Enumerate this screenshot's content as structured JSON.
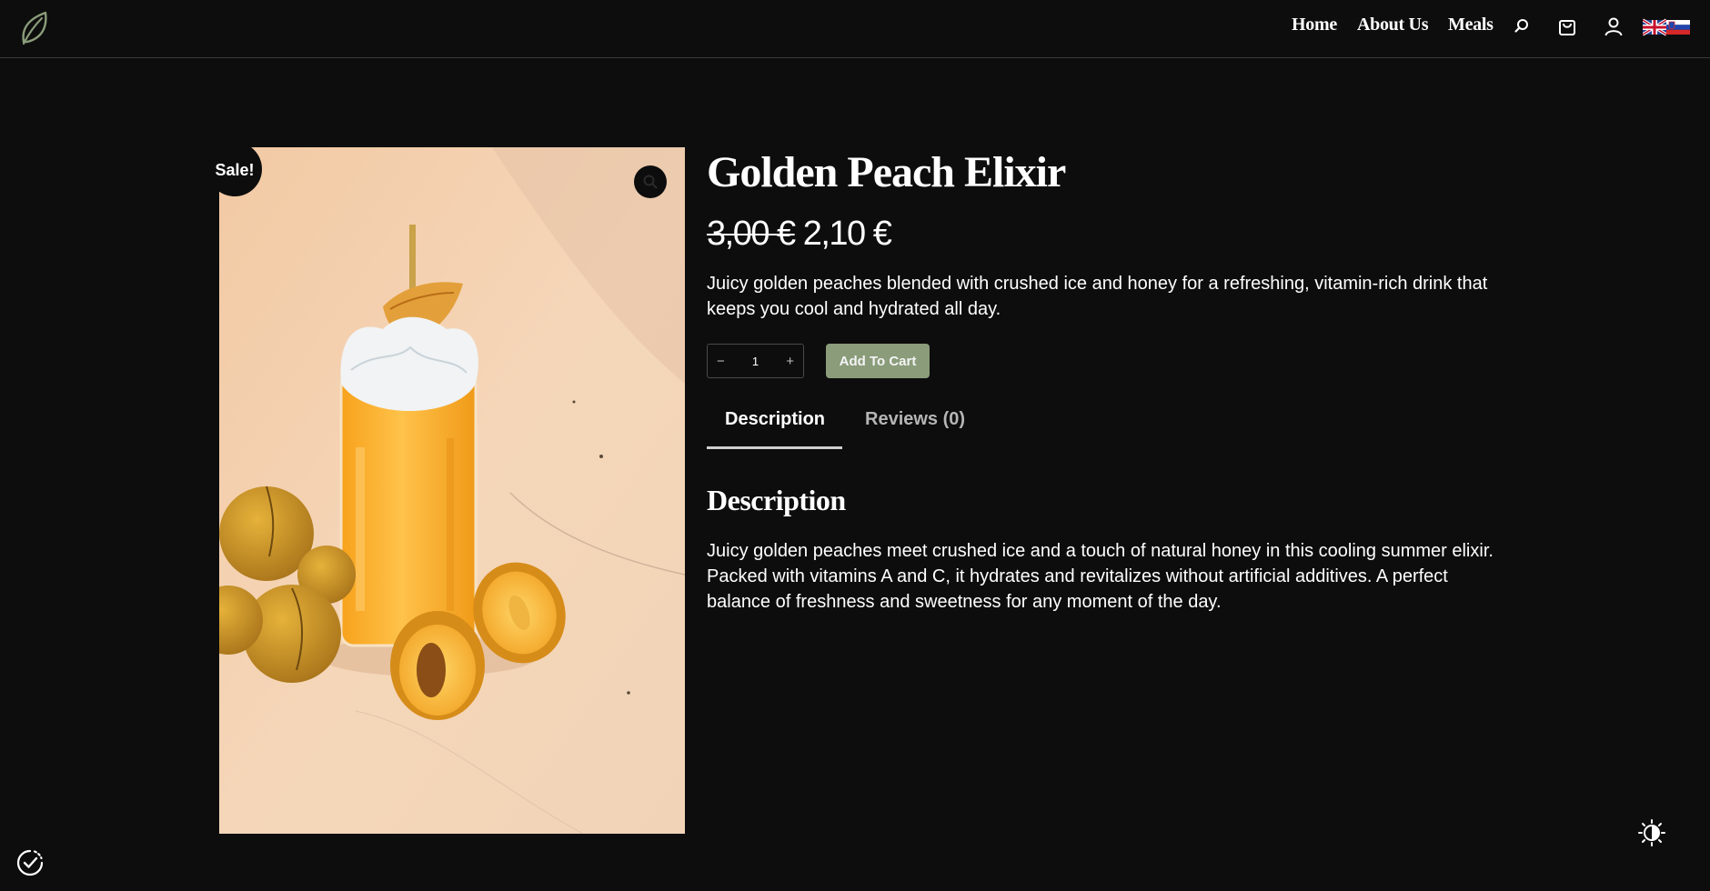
{
  "header": {
    "nav": [
      {
        "label": "Home"
      },
      {
        "label": "About Us"
      },
      {
        "label": "Meals"
      }
    ],
    "icons": [
      "leaf-logo-icon",
      "search-icon",
      "shopping-bag-icon",
      "user-icon",
      "language-flags-icon"
    ]
  },
  "product": {
    "sale_badge": "Sale!",
    "title": "Golden Peach Elixir",
    "price_old": "3,00 €",
    "price_new": "2,10 €",
    "short_description": "Juicy golden peaches blended with crushed ice and honey for a refreshing, vitamin-rich drink that keeps you cool and hydrated all day.",
    "quantity": "1",
    "quantity_minus": "−",
    "quantity_plus": "+",
    "add_to_cart_label": "Add To Cart"
  },
  "tabs": [
    {
      "label": "Description",
      "active": true
    },
    {
      "label": "Reviews (0)",
      "active": false
    }
  ],
  "description": {
    "heading": "Description",
    "paragraph_1": "Juicy golden peaches meet crushed ice and a touch of natural honey in this cooling summer elixir.",
    "paragraph_2": "Packed with vitamins A and C, it hydrates and revitalizes without artificial additives. A perfect balance of freshness and sweetness for any moment of the day."
  },
  "colors": {
    "background": "#0d0d0d",
    "accent_button": "#8a9c7a",
    "text": "#ffffff"
  }
}
